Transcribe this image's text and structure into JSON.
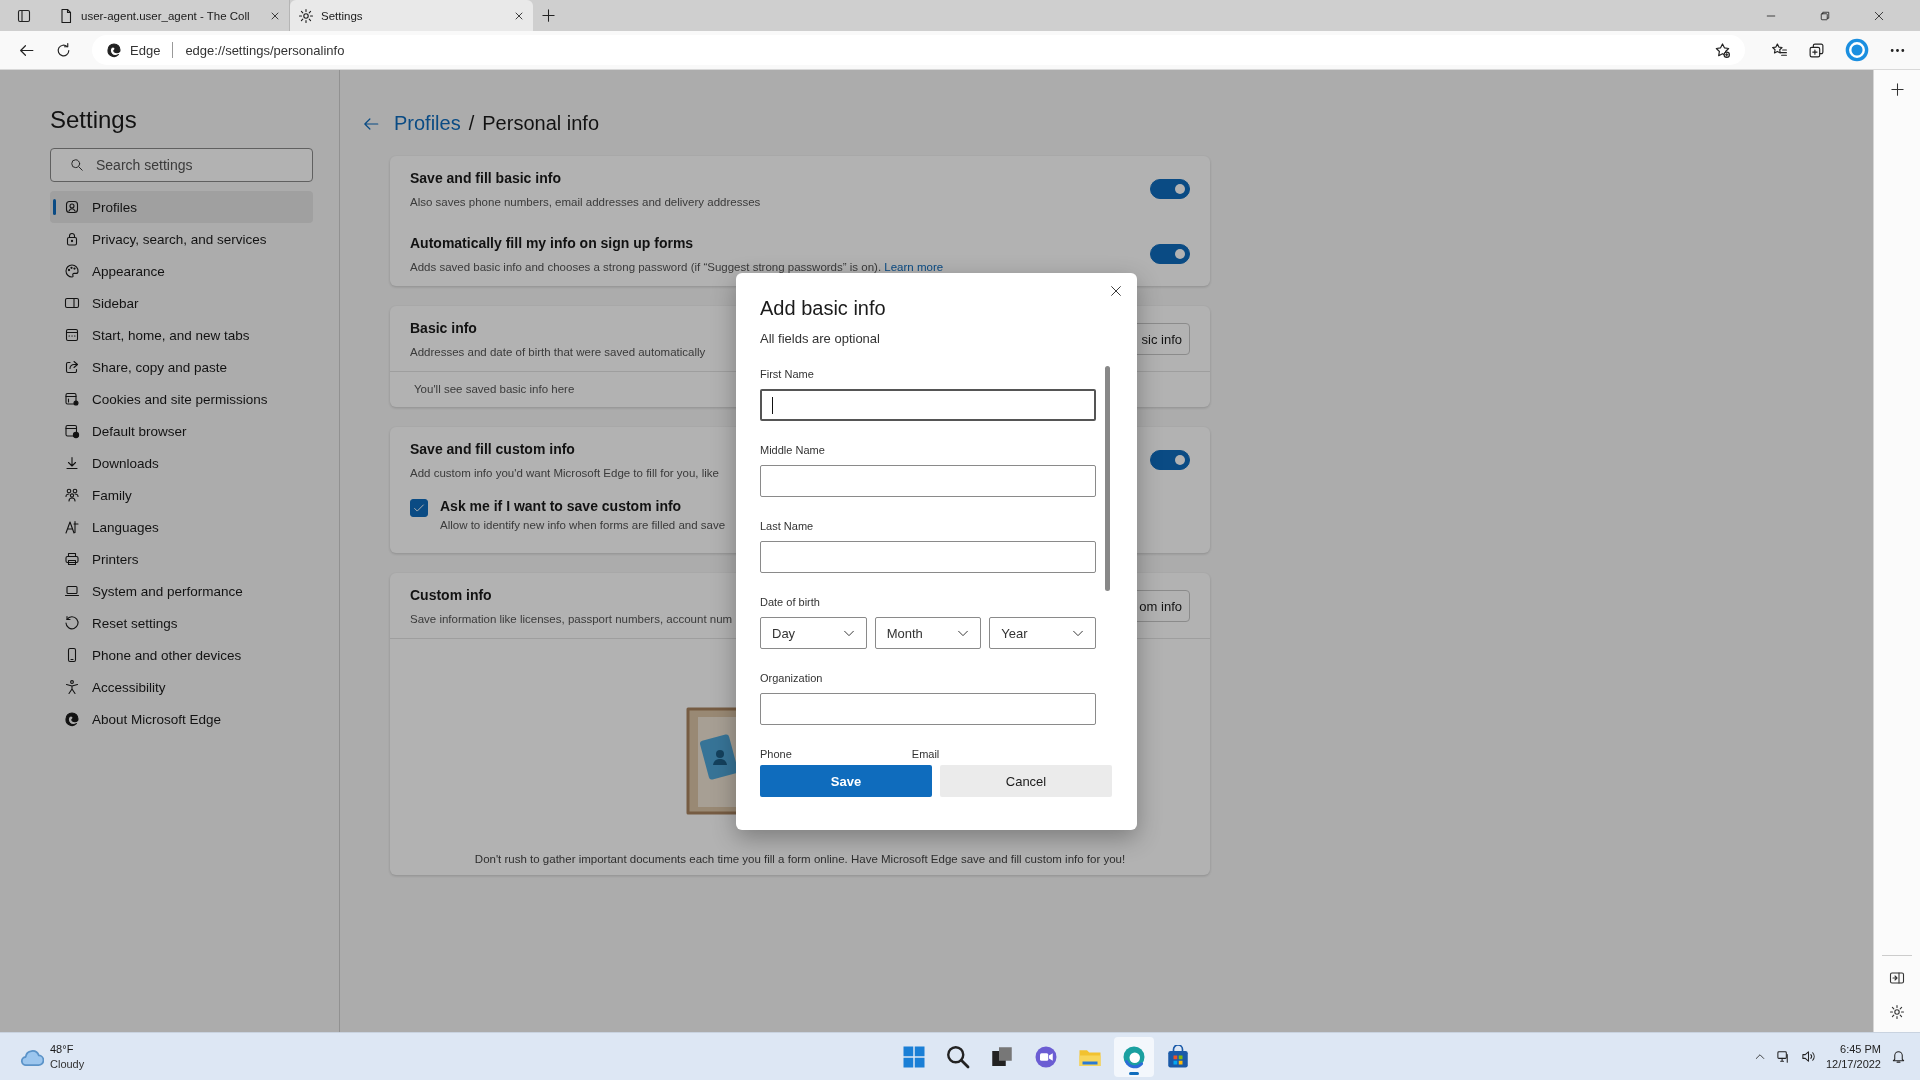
{
  "browser": {
    "tabs": [
      {
        "title": "user-agent.user_agent - The Coll",
        "selected": false
      },
      {
        "title": "Settings",
        "selected": true
      }
    ],
    "address": {
      "site": "Edge",
      "url": "edge://settings/personalinfo"
    }
  },
  "sidebar": {
    "title": "Settings",
    "search": {
      "placeholder": "Search settings"
    },
    "items": [
      {
        "label": "Profiles",
        "selected": true
      },
      {
        "label": "Privacy, search, and services",
        "selected": false
      },
      {
        "label": "Appearance",
        "selected": false
      },
      {
        "label": "Sidebar",
        "selected": false
      },
      {
        "label": "Start, home, and new tabs",
        "selected": false
      },
      {
        "label": "Share, copy and paste",
        "selected": false
      },
      {
        "label": "Cookies and site permissions",
        "selected": false
      },
      {
        "label": "Default browser",
        "selected": false
      },
      {
        "label": "Downloads",
        "selected": false
      },
      {
        "label": "Family",
        "selected": false
      },
      {
        "label": "Languages",
        "selected": false
      },
      {
        "label": "Printers",
        "selected": false
      },
      {
        "label": "System and performance",
        "selected": false
      },
      {
        "label": "Reset settings",
        "selected": false
      },
      {
        "label": "Phone and other devices",
        "selected": false
      },
      {
        "label": "Accessibility",
        "selected": false
      },
      {
        "label": "About Microsoft Edge",
        "selected": false
      }
    ]
  },
  "page": {
    "breadcrumb": {
      "parent": "Profiles",
      "separator": "/",
      "current": "Personal info"
    },
    "cards": [
      {
        "rows": [
          {
            "kind": "toggle",
            "title": "Save and fill basic info",
            "description": "Also saves phone numbers, email addresses and delivery addresses",
            "on": true
          },
          {
            "kind": "toggle",
            "title": "Automatically fill my info on sign up forms",
            "description": "Adds saved basic info and chooses a strong password (if “Suggest strong passwords” is on).",
            "link": "Learn more",
            "on": true
          }
        ]
      },
      {
        "rows": [
          {
            "kind": "header",
            "title": "Basic info",
            "description": "Addresses and date of birth that were saved automatically",
            "button": "sic info"
          },
          {
            "kind": "note",
            "text": "You'll see saved basic info here"
          }
        ]
      },
      {
        "rows": [
          {
            "kind": "toggle",
            "title": "Save and fill custom info",
            "description": "Add custom info you'd want Microsoft Edge to fill for you, like",
            "on": true
          },
          {
            "kind": "checkbox",
            "title": "Ask me if I want to save custom info",
            "description": "Allow to identify new info when forms are filled and save",
            "checked": true
          }
        ]
      },
      {
        "rows": [
          {
            "kind": "header",
            "title": "Custom info",
            "description": "Save information like licenses, passport numbers, account num",
            "button": "om info"
          },
          {
            "kind": "illustration",
            "text": "Don't rush to gather important documents each time you fill a form online. Have Microsoft Edge save and fill custom info for you!"
          }
        ]
      }
    ]
  },
  "dialog": {
    "title": "Add basic info",
    "subtitle": "All fields are optional",
    "fields": [
      {
        "kind": "text",
        "label": "First Name",
        "focused": true
      },
      {
        "kind": "text",
        "label": "Middle Name",
        "focused": false
      },
      {
        "kind": "text",
        "label": "Last Name",
        "focused": false
      },
      {
        "kind": "selects",
        "label": "Date of birth",
        "options": [
          "Day",
          "Month",
          "Year"
        ],
        "focused": false
      },
      {
        "kind": "text",
        "label": "Organization",
        "focused": false
      },
      {
        "kind": "pair",
        "labels": [
          "Phone",
          "Email"
        ],
        "focused": false
      }
    ],
    "buttons": [
      {
        "label": "Save",
        "primary": true
      },
      {
        "label": "Cancel",
        "primary": false
      }
    ]
  },
  "taskbar": {
    "weather": {
      "temperature": "48°F",
      "condition": "Cloudy"
    },
    "apps": [
      {
        "selected": false
      },
      {
        "selected": false
      },
      {
        "selected": false
      },
      {
        "selected": false
      },
      {
        "selected": false
      },
      {
        "selected": true
      },
      {
        "selected": false
      }
    ],
    "time": "6:45 PM",
    "date": "12/17/2022"
  }
}
